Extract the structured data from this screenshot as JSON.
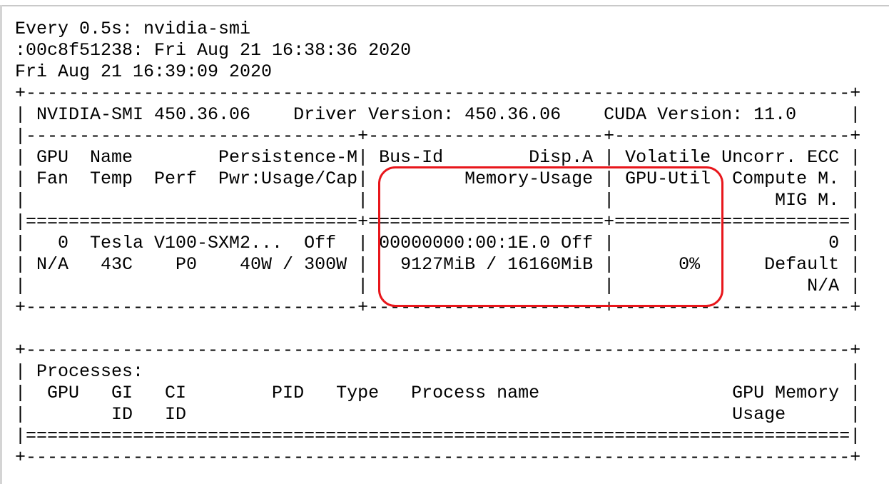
{
  "header": {
    "watch_command": "Every 0.5s: nvidia-smi",
    "host_line": ":00c8f51238: Fri Aug 21 16:38:36 2020",
    "date_line": "Fri Aug 21 16:39:09 2020"
  },
  "gpu_table": {
    "border_top": "+-----------------------------------------------------------------------------+",
    "version_row": "| NVIDIA-SMI 450.36.06    Driver Version: 450.36.06    CUDA Version: 11.0     |",
    "separator_1": "|-------------------------------+----------------------+----------------------+",
    "header_row_1": "| GPU  Name        Persistence-M| Bus-Id        Disp.A | Volatile Uncorr. ECC |",
    "header_row_2": "| Fan  Temp  Perf  Pwr:Usage/Cap|         Memory-Usage | GPU-Util  Compute M. |",
    "header_row_3": "|                               |                      |               MIG M. |",
    "separator_2": "|===============================+======================+======================|",
    "data_row_1": "|   0  Tesla V100-SXM2...  Off  | 00000000:00:1E.0 Off |                    0 |",
    "data_row_2": "| N/A   43C    P0    40W / 300W |   9127MiB / 16160MiB |      0%      Default |",
    "data_row_3": "|                               |                      |                  N/A |",
    "border_bottom": "+-------------------------------+----------------------+----------------------+"
  },
  "process_table": {
    "border_top": "+-----------------------------------------------------------------------------+",
    "title_row": "| Processes:                                                                  |",
    "header_row_1": "|  GPU   GI   CI        PID   Type   Process name                  GPU Memory |",
    "header_row_2": "|        ID   ID                                                   Usage      |",
    "separator": "|=============================================================================|",
    "border_bottom": "+-----------------------------------------------------------------------------+"
  },
  "annotation": {
    "highlight_color": "#e8161b"
  }
}
